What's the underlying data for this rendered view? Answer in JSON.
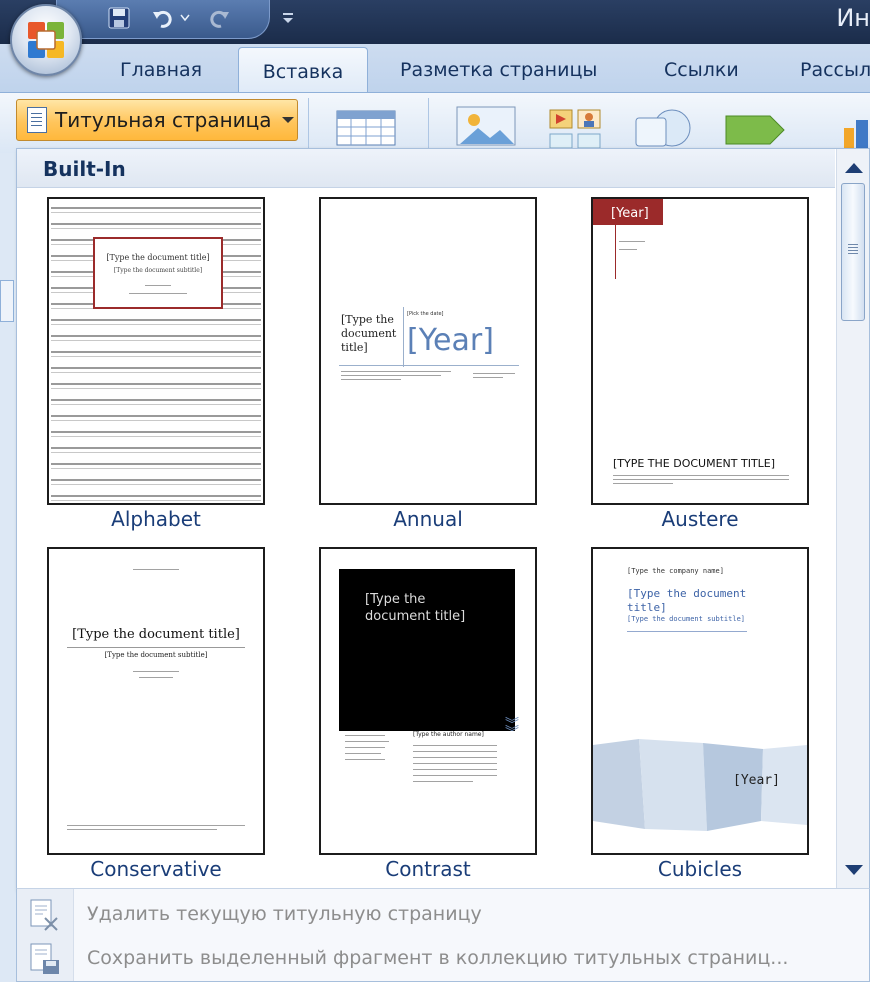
{
  "window": {
    "title": "Ин"
  },
  "qat": {
    "icons": [
      "save-icon",
      "undo-icon",
      "redo-icon",
      "customize-icon"
    ]
  },
  "tabs": [
    {
      "label": "Главная",
      "active": false
    },
    {
      "label": "Вставка",
      "active": true
    },
    {
      "label": "Разметка страницы",
      "active": false
    },
    {
      "label": "Ссылки",
      "active": false
    },
    {
      "label": "Рассыл",
      "active": false
    }
  ],
  "ribbon": {
    "cover_page_button": "Титульная страница"
  },
  "gallery": {
    "section_title": "Built-In",
    "items": [
      {
        "name": "Alphabet",
        "preview": {
          "title": "[Type the document title]",
          "subtitle": "[Type the document subtitle]"
        }
      },
      {
        "name": "Annual",
        "preview": {
          "title": "[Type the document title]",
          "date": "[Pick the date]",
          "year": "[Year]"
        }
      },
      {
        "name": "Austere",
        "preview": {
          "year": "[Year]",
          "title": "[TYPE THE DOCUMENT TITLE]"
        }
      },
      {
        "name": "Conservative",
        "preview": {
          "title": "[Type the document title]",
          "subtitle": "[Type the document subtitle]"
        }
      },
      {
        "name": "Contrast",
        "preview": {
          "title": "[Type the document title]",
          "author": "[Type the author name]"
        }
      },
      {
        "name": "Cubicles",
        "preview": {
          "company": "[Type the company name]",
          "title": "[Type the document title]",
          "subtitle": "[Type the document subtitle]",
          "year": "[Year]"
        }
      }
    ]
  },
  "menu": {
    "remove": "Удалить текущую титульную страницу",
    "save": "Сохранить выделенный фрагмент в коллекцию титульных страниц..."
  },
  "colors": {
    "accent": "#1a3d78",
    "button_gold": "#ffc55c",
    "austere_red": "#9b2a2a",
    "annual_blue": "#5b80b6"
  }
}
